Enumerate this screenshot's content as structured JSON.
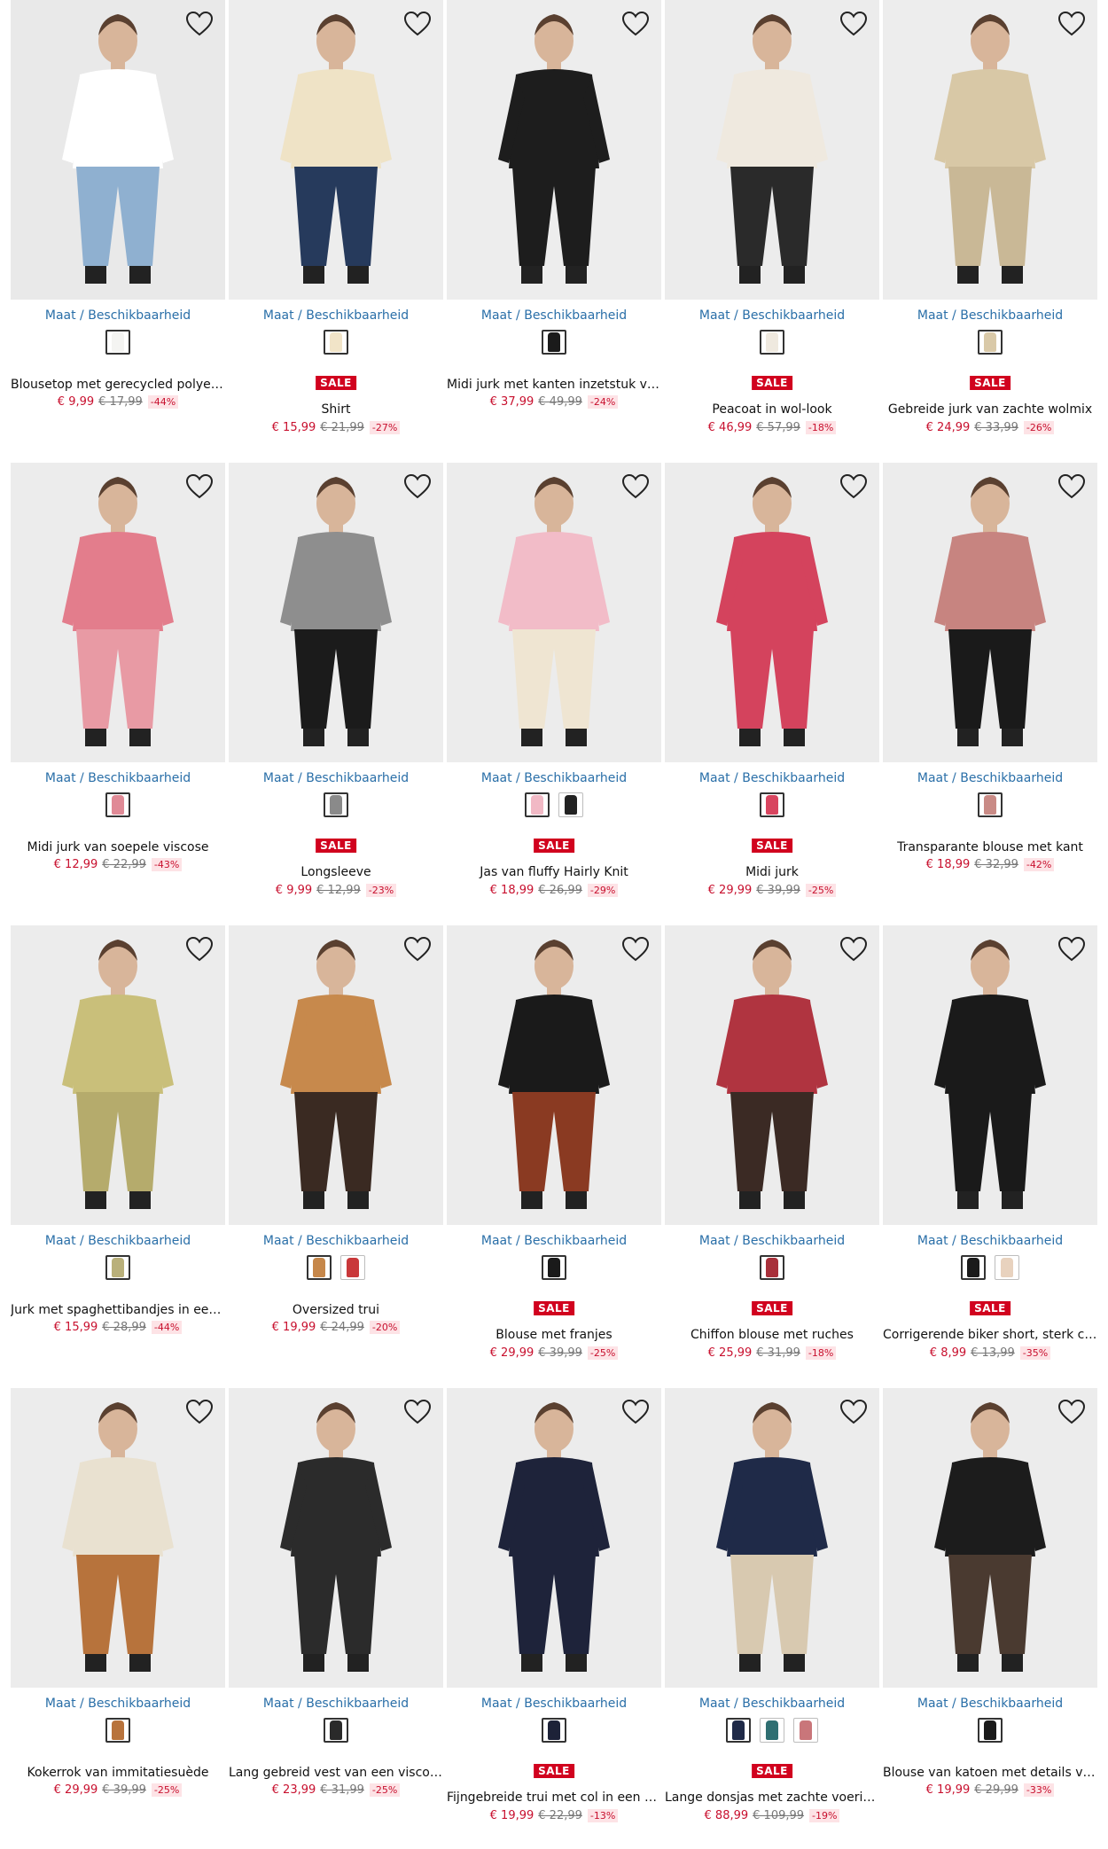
{
  "availability_label": "Maat / Beschikbaarheid",
  "sale_label": "SALE",
  "icons": {
    "favorite": "heart-outline-icon"
  },
  "colors": {
    "accent_blue": "#2a6fa8",
    "sale_red": "#d1021e",
    "price_red": "#c8102e"
  },
  "products": [
    {
      "name": "Blousetop met gerecycled polyester",
      "price": "€ 9,99",
      "old_price": "€ 17,99",
      "discount": "-44%",
      "sale": false,
      "swatches": [
        "#f4f4f2"
      ],
      "top": "#ffffff",
      "bottom": "#8fb0d0",
      "bg": "#e9e9e9"
    },
    {
      "name": "Shirt",
      "price": "€ 15,99",
      "old_price": "€ 21,99",
      "discount": "-27%",
      "sale": true,
      "swatches": [
        "#f1e4c8"
      ],
      "top": "#efe3c6",
      "bottom": "#263a5c",
      "bg": "#ededed"
    },
    {
      "name": "Midi jurk met kanten inzetstuk van ...",
      "price": "€ 37,99",
      "old_price": "€ 49,99",
      "discount": "-24%",
      "sale": false,
      "swatches": [
        "#1b1b1b"
      ],
      "top": "#1d1d1d",
      "bottom": "#1d1d1d",
      "bg": "#ededed"
    },
    {
      "name": "Peacoat in wol-look",
      "price": "€ 46,99",
      "old_price": "€ 57,99",
      "discount": "-18%",
      "sale": true,
      "swatches": [
        "#efe9df"
      ],
      "top": "#efe9df",
      "bottom": "#2a2a2a",
      "bg": "#ececec"
    },
    {
      "name": "Gebreide jurk van zachte wolmix",
      "price": "€ 24,99",
      "old_price": "€ 33,99",
      "discount": "-26%",
      "sale": true,
      "swatches": [
        "#d9c9a8"
      ],
      "top": "#d8c8a6",
      "bottom": "#c9b896",
      "bg": "#ededed"
    },
    {
      "name": "Midi jurk van soepele viscose",
      "price": "€ 12,99",
      "old_price": "€ 22,99",
      "discount": "-43%",
      "sale": false,
      "swatches": [
        "#e08a96"
      ],
      "top": "#e37d8c",
      "bottom": "#e89aa4",
      "bg": "#ececec"
    },
    {
      "name": "Longsleeve",
      "price": "€ 9,99",
      "old_price": "€ 12,99",
      "discount": "-23%",
      "sale": true,
      "swatches": [
        "#8a8a8a"
      ],
      "top": "#8e8e8e",
      "bottom": "#1b1b1b",
      "bg": "#ededed"
    },
    {
      "name": "Jas van fluffy Hairly Knit",
      "price": "€ 18,99",
      "old_price": "€ 26,99",
      "discount": "-29%",
      "sale": true,
      "swatches": [
        "#f1b9c5",
        "#222222"
      ],
      "top": "#f2bcc8",
      "bottom": "#efe5d2",
      "bg": "#ececec"
    },
    {
      "name": "Midi jurk",
      "price": "€ 29,99",
      "old_price": "€ 39,99",
      "discount": "-25%",
      "sale": true,
      "swatches": [
        "#d8455f"
      ],
      "top": "#d4435d",
      "bottom": "#d4435d",
      "bg": "#ececec"
    },
    {
      "name": "Transparante blouse met kant",
      "price": "€ 18,99",
      "old_price": "€ 32,99",
      "discount": "-42%",
      "sale": false,
      "swatches": [
        "#c98b86"
      ],
      "top": "#c78480",
      "bottom": "#1a1a1a",
      "bg": "#ececec"
    },
    {
      "name": "Jurk met spaghettibandjes in een z...",
      "price": "€ 15,99",
      "old_price": "€ 28,99",
      "discount": "-44%",
      "sale": false,
      "swatches": [
        "#b9b07a"
      ],
      "top": "#c9bf7a",
      "bottom": "#b5ab6c",
      "bg": "#ececec"
    },
    {
      "name": "Oversized trui",
      "price": "€ 19,99",
      "old_price": "€ 24,99",
      "discount": "-20%",
      "sale": false,
      "swatches": [
        "#c6874a",
        "#c9383a"
      ],
      "top": "#c7894c",
      "bottom": "#3a2a22",
      "bg": "#ececec"
    },
    {
      "name": "Blouse met franjes",
      "price": "€ 29,99",
      "old_price": "€ 39,99",
      "discount": "-25%",
      "sale": true,
      "swatches": [
        "#1a1a1a"
      ],
      "top": "#1a1a1a",
      "bottom": "#8a3a22",
      "bg": "#ececec"
    },
    {
      "name": "Chiffon blouse met ruches",
      "price": "€ 25,99",
      "old_price": "€ 31,99",
      "discount": "-18%",
      "sale": true,
      "swatches": [
        "#a8303a"
      ],
      "top": "#b03440",
      "bottom": "#3b2a24",
      "bg": "#ececec"
    },
    {
      "name": "Corrigerende biker short, sterk cor...",
      "price": "€ 8,99",
      "old_price": "€ 13,99",
      "discount": "-35%",
      "sale": true,
      "swatches": [
        "#1a1a1a",
        "#e8d2be"
      ],
      "top": "#1a1a1a",
      "bottom": "#1a1a1a",
      "bg": "#ececec"
    },
    {
      "name": "Kokerrok van immitatiesuède",
      "price": "€ 29,99",
      "old_price": "€ 39,99",
      "discount": "-25%",
      "sale": false,
      "swatches": [
        "#b8733c"
      ],
      "top": "#e9e1d0",
      "bottom": "#b7733c",
      "bg": "#ececec"
    },
    {
      "name": "Lang gebreid vest van een viscosemix",
      "price": "€ 23,99",
      "old_price": "€ 31,99",
      "discount": "-25%",
      "sale": false,
      "swatches": [
        "#2a2a2a"
      ],
      "top": "#2b2b2b",
      "bottom": "#2b2b2b",
      "bg": "#ececec"
    },
    {
      "name": "Fijngebreide trui met col in een vis...",
      "price": "€ 19,99",
      "old_price": "€ 22,99",
      "discount": "-13%",
      "sale": true,
      "swatches": [
        "#1d2238"
      ],
      "top": "#1e233a",
      "bottom": "#1e233a",
      "bg": "#ececec"
    },
    {
      "name": "Lange donsjas met zachte voering, ...",
      "price": "€ 88,99",
      "old_price": "€ 109,99",
      "discount": "-19%",
      "sale": true,
      "swatches": [
        "#1f2a48",
        "#2f6f72",
        "#c9767a"
      ],
      "top": "#1f2a48",
      "bottom": "#d8c9b0",
      "bg": "#ececec"
    },
    {
      "name": "Blouse van katoen met details van k...",
      "price": "€ 19,99",
      "old_price": "€ 29,99",
      "discount": "-33%",
      "sale": false,
      "swatches": [
        "#1a1a1a"
      ],
      "top": "#1c1c1c",
      "bottom": "#4a3a30",
      "bg": "#ececec"
    }
  ]
}
